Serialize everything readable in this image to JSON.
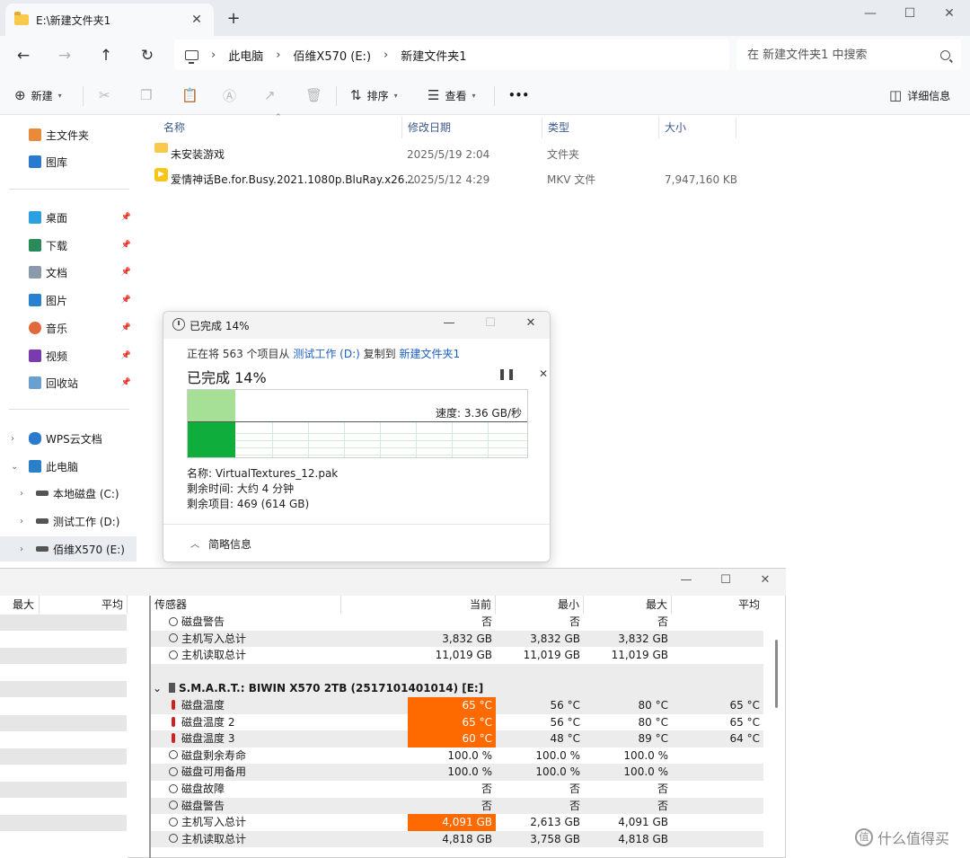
{
  "explorer": {
    "tab_title": "E:\\新建文件夹1",
    "breadcrumb": [
      "此电脑",
      "佰维X570 (E:)",
      "新建文件夹1"
    ],
    "search_placeholder": "在 新建文件夹1 中搜索",
    "toolbar": {
      "new_label": "新建",
      "sort_label": "排序",
      "view_label": "查看",
      "more_label": "•••",
      "details_label": "详细信息"
    },
    "sidebar": {
      "top": [
        {
          "label": "主文件夹",
          "icon": "home-icon"
        },
        {
          "label": "图库",
          "icon": "gallery-icon"
        }
      ],
      "quick": [
        {
          "label": "桌面",
          "icon": "desktop-icon",
          "color": "#2aa0e0"
        },
        {
          "label": "下载",
          "icon": "download-icon",
          "color": "#2a8a5a"
        },
        {
          "label": "文档",
          "icon": "documents-icon",
          "color": "#8a9aaa"
        },
        {
          "label": "图片",
          "icon": "pictures-icon",
          "color": "#2a80d0"
        },
        {
          "label": "音乐",
          "icon": "music-icon",
          "color": "#e06a3a"
        },
        {
          "label": "视频",
          "icon": "videos-icon",
          "color": "#7a3ab0"
        },
        {
          "label": "回收站",
          "icon": "recycle-bin-icon",
          "color": "#6aa0d0"
        }
      ],
      "tree": [
        {
          "label": "WPS云文档",
          "icon": "cloud-icon"
        },
        {
          "label": "此电脑",
          "icon": "pc-icon"
        },
        {
          "label": "本地磁盘 (C:)",
          "icon": "drive-icon"
        },
        {
          "label": "测试工作 (D:)",
          "icon": "drive-icon"
        },
        {
          "label": "佰维X570 (E:)",
          "icon": "drive-icon"
        }
      ]
    },
    "columns": [
      "名称",
      "修改日期",
      "类型",
      "大小"
    ],
    "files": [
      {
        "name": "未安装游戏",
        "date": "2025/5/19 2:04",
        "type": "文件夹",
        "size": ""
      },
      {
        "name": "爱情神话Be.for.Busy.2021.1080p.BluRay.x26...",
        "date": "2025/5/12 4:29",
        "type": "MKV 文件",
        "size": "7,947,160 KB"
      }
    ]
  },
  "copy_dialog": {
    "title": "已完成 14%",
    "line_prefix": "正在将 563 个项目从 ",
    "source": "测试工作 (D:)",
    "line_mid": " 复制到 ",
    "dest": "新建文件夹1",
    "progress_text": "已完成 14%",
    "progress_fraction": 0.14,
    "speed": "速度: 3.36 GB/秒",
    "name_line": "名称:  VirtualTextures_12.pak",
    "time_line": "剩余时间:  大约 4 分钟",
    "items_line": "剩余项目:  469 (614 GB)",
    "less_details": "简略信息",
    "colors": {
      "fill_light": "#a6e097",
      "fill_dark": "#0fae3c"
    }
  },
  "sensor": {
    "left_headers": [
      "最大",
      "平均"
    ],
    "headers": [
      "传感器",
      "当前",
      "最小",
      "最大",
      "平均"
    ],
    "rows": [
      {
        "kind": "item",
        "icon": "clock-icon",
        "name": "磁盘警告",
        "cur": "否",
        "min": "否",
        "max": "否",
        "avg": ""
      },
      {
        "kind": "item",
        "icon": "clock-icon",
        "name": "主机写入总计",
        "cur": "3,832 GB",
        "min": "3,832 GB",
        "max": "3,832 GB",
        "avg": ""
      },
      {
        "kind": "item",
        "icon": "clock-icon",
        "name": "主机读取总计",
        "cur": "11,019 GB",
        "min": "11,019 GB",
        "max": "11,019 GB",
        "avg": ""
      },
      {
        "kind": "blank"
      },
      {
        "kind": "group",
        "name": "S.M.A.R.T.: BIWIN X570 2TB (2517101401014) [E:]"
      },
      {
        "kind": "item",
        "icon": "thermometer-icon",
        "name": "磁盘温度",
        "cur": "65 °C",
        "min": "56 °C",
        "max": "80 °C",
        "avg": "65 °C",
        "hot": true
      },
      {
        "kind": "item",
        "icon": "thermometer-icon",
        "name": "磁盘温度 2",
        "cur": "65 °C",
        "min": "56 °C",
        "max": "80 °C",
        "avg": "65 °C",
        "hot": true
      },
      {
        "kind": "item",
        "icon": "thermometer-icon",
        "name": "磁盘温度 3",
        "cur": "60 °C",
        "min": "48 °C",
        "max": "89 °C",
        "avg": "64 °C",
        "hot": true
      },
      {
        "kind": "item",
        "icon": "clock-icon",
        "name": "磁盘剩余寿命",
        "cur": "100.0 %",
        "min": "100.0 %",
        "max": "100.0 %",
        "avg": ""
      },
      {
        "kind": "item",
        "icon": "clock-icon",
        "name": "磁盘可用备用",
        "cur": "100.0 %",
        "min": "100.0 %",
        "max": "100.0 %",
        "avg": ""
      },
      {
        "kind": "item",
        "icon": "clock-icon",
        "name": "磁盘故障",
        "cur": "否",
        "min": "否",
        "max": "否",
        "avg": ""
      },
      {
        "kind": "item",
        "icon": "clock-icon",
        "name": "磁盘警告",
        "cur": "否",
        "min": "否",
        "max": "否",
        "avg": ""
      },
      {
        "kind": "item",
        "icon": "clock-icon",
        "name": "主机写入总计",
        "cur": "4,091 GB",
        "min": "2,613 GB",
        "max": "4,091 GB",
        "avg": "",
        "hot": true
      },
      {
        "kind": "item",
        "icon": "clock-icon",
        "name": "主机读取总计",
        "cur": "4,818 GB",
        "min": "3,758 GB",
        "max": "4,818 GB",
        "avg": ""
      }
    ],
    "hot_color": "#ff6a00"
  },
  "watermark": "什么值得买"
}
